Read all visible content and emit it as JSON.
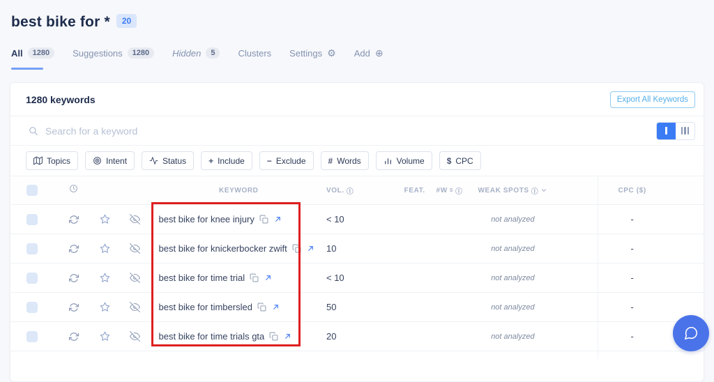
{
  "page": {
    "title": "best bike for *",
    "title_badge": "20"
  },
  "tabs": [
    {
      "label": "All",
      "badge": "1280"
    },
    {
      "label": "Suggestions",
      "badge": "1280"
    },
    {
      "label": "Hidden",
      "badge": "5"
    },
    {
      "label": "Clusters"
    },
    {
      "label": "Settings",
      "icon": "⚙"
    },
    {
      "label": "Add",
      "icon": "⊕"
    }
  ],
  "card": {
    "count_label": "1280 keywords",
    "export_button": "Export All Keywords",
    "search_placeholder": "Search for a keyword",
    "filters": [
      {
        "label": "Topics"
      },
      {
        "label": "Intent"
      },
      {
        "label": "Status"
      },
      {
        "glyph": "+",
        "label": "Include"
      },
      {
        "glyph": "−",
        "label": "Exclude"
      },
      {
        "glyph": "#",
        "label": "Words"
      },
      {
        "label": "Volume"
      },
      {
        "glyph": "$",
        "label": "CPC"
      }
    ]
  },
  "table": {
    "headers": {
      "keyword": "KEYWORD",
      "vol": "VOL.",
      "feat": "FEAT.",
      "words": "#W",
      "words_sup": "S",
      "weak": "WEAK SPOTS",
      "cpc": "CPC ($)",
      "info_glyph": "ⓘ"
    },
    "rows": [
      {
        "keyword": "best bike for knee injury",
        "vol": "< 10",
        "feat": "",
        "words": "",
        "weak": "not analyzed",
        "cpc": "-"
      },
      {
        "keyword": "best bike for knickerbocker zwift",
        "vol": "10",
        "feat": "",
        "words": "",
        "weak": "not analyzed",
        "cpc": "-"
      },
      {
        "keyword": "best bike for time trial",
        "vol": "< 10",
        "feat": "",
        "words": "",
        "weak": "not analyzed",
        "cpc": "-"
      },
      {
        "keyword": "best bike for timbersled",
        "vol": "50",
        "feat": "",
        "words": "",
        "weak": "not analyzed",
        "cpc": "-"
      },
      {
        "keyword": "best bike for time trials gta",
        "vol": "20",
        "feat": "",
        "words": "",
        "weak": "not analyzed",
        "cpc": "-"
      }
    ]
  },
  "colors": {
    "accent_blue": "#3f7df5",
    "export_blue": "#53aee8",
    "annotation_red": "#de1f1f",
    "chat_blue": "#4a73e9",
    "title_navy": "#1d2c4c"
  }
}
